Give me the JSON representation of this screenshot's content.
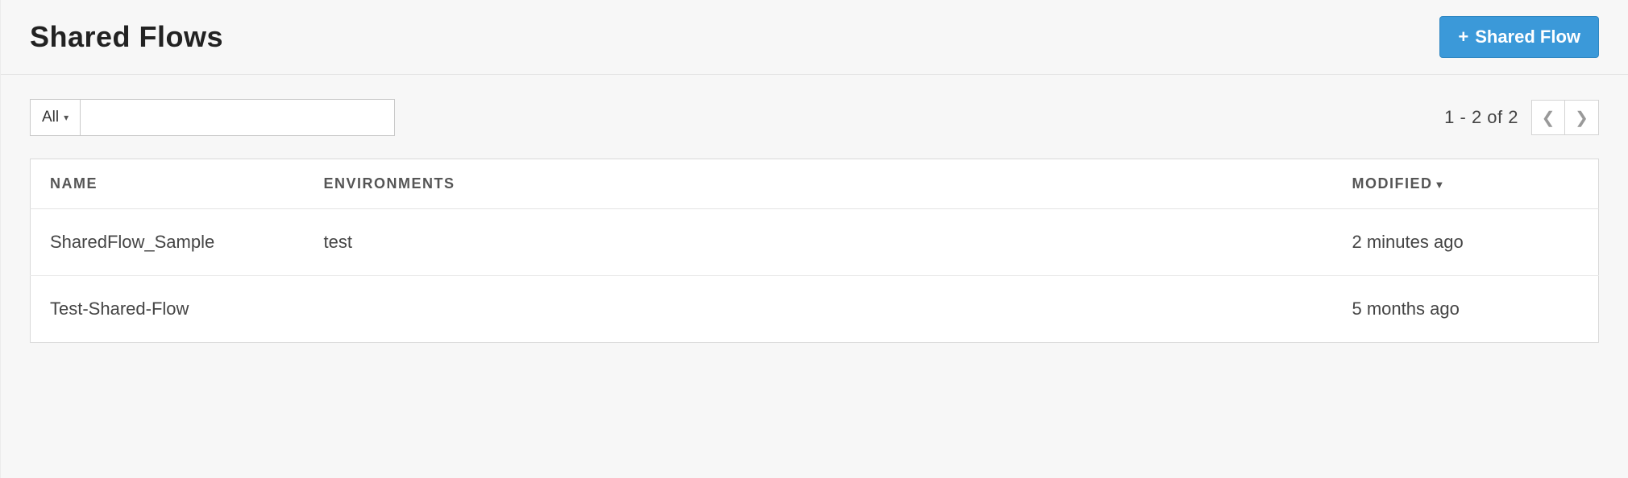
{
  "header": {
    "title": "Shared Flows",
    "create_button_label": "Shared Flow"
  },
  "toolbar": {
    "filter_label": "All",
    "search_value": ""
  },
  "pagination": {
    "text": "1 - 2 of 2"
  },
  "table": {
    "columns": {
      "name": "NAME",
      "environments": "ENVIRONMENTS",
      "modified": "MODIFIED"
    },
    "sort_indicator": "▼",
    "rows": [
      {
        "name": "SharedFlow_Sample",
        "environments": "test",
        "modified": "2 minutes ago"
      },
      {
        "name": "Test-Shared-Flow",
        "environments": "",
        "modified": "5 months ago"
      }
    ]
  }
}
